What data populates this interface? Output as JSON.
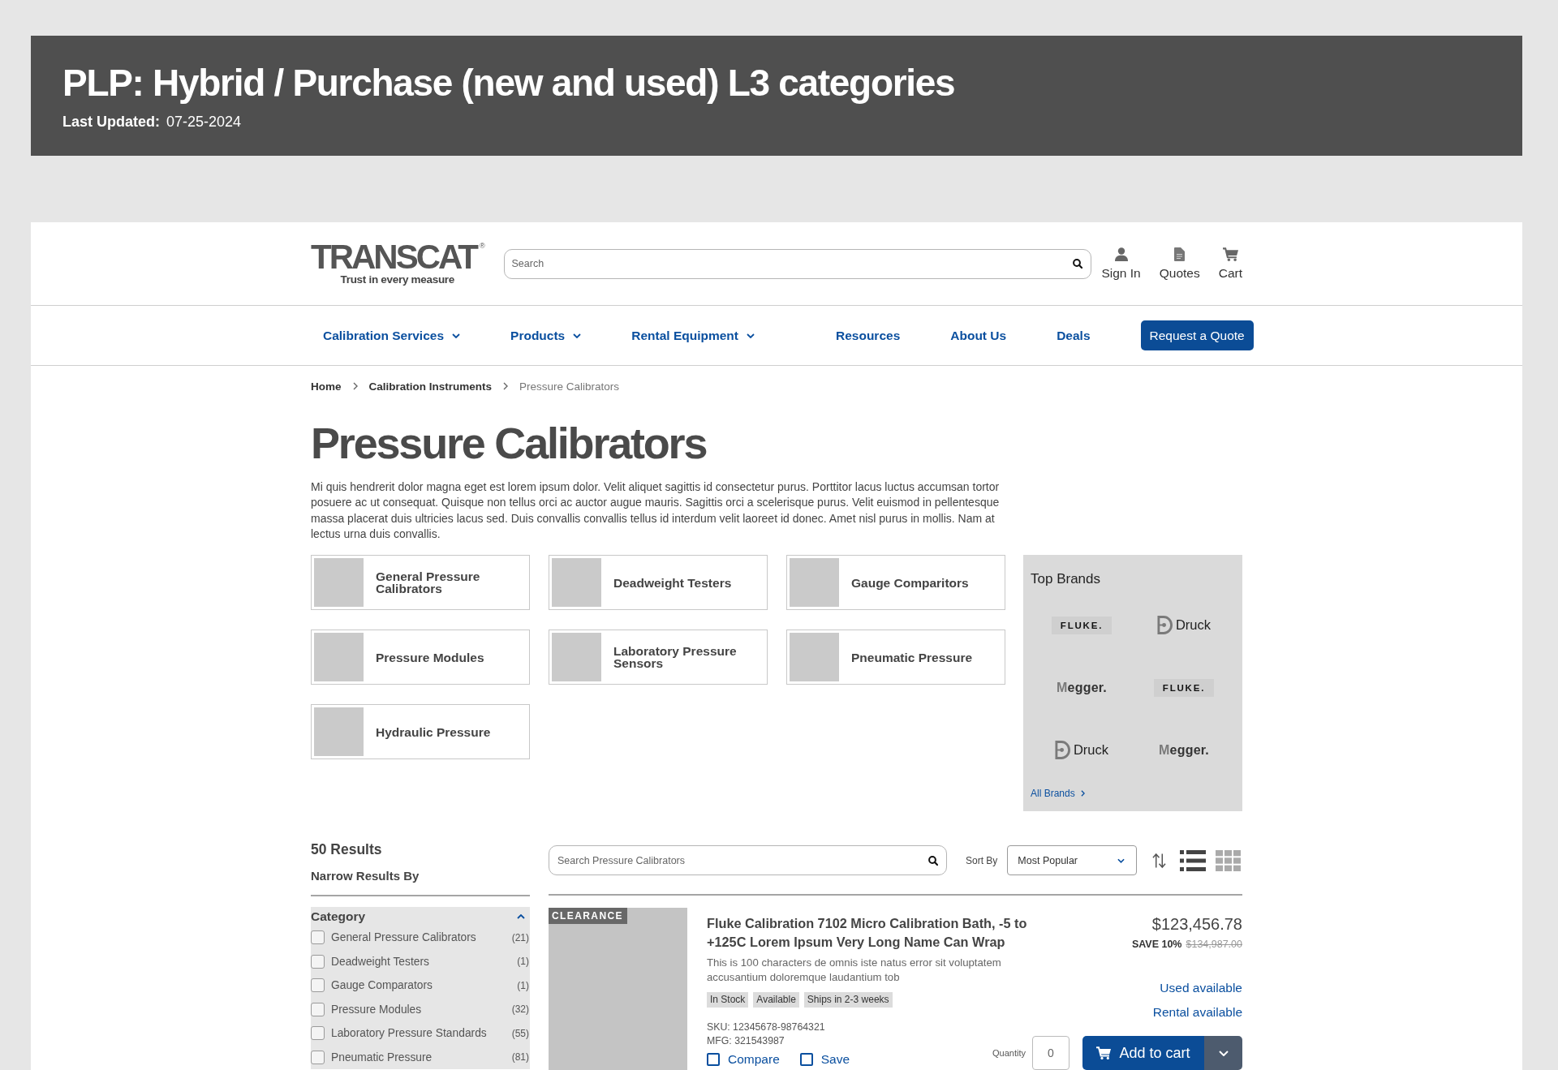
{
  "banner": {
    "title": "PLP: Hybrid / Purchase (new and used) L3 categories",
    "updated_label": "Last Updated:",
    "updated_value": "07-25-2024"
  },
  "header": {
    "logo": {
      "wordmark": "TRANSCAT",
      "registered": "®",
      "tagline": "Trust in every measure"
    },
    "search": {
      "placeholder": "Search"
    },
    "actions": [
      {
        "kind": "account",
        "label": "Sign In"
      },
      {
        "kind": "quotes",
        "label": "Quotes"
      },
      {
        "kind": "cart",
        "label": "Cart"
      }
    ]
  },
  "nav": {
    "items": [
      {
        "label": "Calibration Services",
        "dropdown": true
      },
      {
        "label": "Products",
        "dropdown": true
      },
      {
        "label": "Rental Equipment",
        "dropdown": true
      },
      {
        "label": "Resources",
        "dropdown": false
      },
      {
        "label": "About Us",
        "dropdown": false
      },
      {
        "label": "Deals",
        "dropdown": false
      }
    ],
    "cta": "Request a Quote"
  },
  "breadcrumb": [
    {
      "label": "Home",
      "current": false
    },
    {
      "label": "Calibration Instruments",
      "current": false
    },
    {
      "label": "Pressure Calibrators",
      "current": true
    }
  ],
  "page_title": "Pressure Calibrators",
  "intro": "Mi quis hendrerit dolor magna eget est lorem ipsum dolor. Velit aliquet sagittis id consectetur purus. Porttitor lacus luctus accumsan tortor posuere ac ut consequat. Quisque non tellus orci ac auctor augue mauris. Sagittis orci a scelerisque purus. Velit euismod in pellentesque massa placerat duis ultricies lacus sed. Duis convallis convallis tellus id interdum velit laoreet id donec. Amet nisl purus in mollis. Nam at lectus urna duis convallis.",
  "categories": [
    "General Pressure Calibrators",
    "Deadweight Testers",
    "Gauge Comparitors",
    "Pressure Modules",
    "Laboratory Pressure Sensors",
    "Pneumatic Pressure",
    "Hydraulic Pressure"
  ],
  "top_brands": {
    "title": "Top Brands",
    "brands": [
      {
        "kind": "boxed",
        "name": "FLUKE."
      },
      {
        "kind": "emblem",
        "name": "Druck"
      },
      {
        "kind": "wordmark",
        "name": "Megger."
      },
      {
        "kind": "boxed",
        "name": "FLUKE."
      },
      {
        "kind": "emblem",
        "name": "Druck"
      },
      {
        "kind": "wordmark",
        "name": "Megger."
      }
    ],
    "link": "All Brands"
  },
  "results": {
    "count": "50 Results",
    "narrow_heading": "Narrow Results By",
    "search": {
      "placeholder": "Search Pressure Calibrators"
    },
    "sort": {
      "label": "Sort By",
      "value": "Most Popular"
    },
    "views": [
      {
        "kind": "list",
        "selected": true
      },
      {
        "kind": "grid",
        "selected": false
      }
    ]
  },
  "filters": [
    {
      "title": "Category",
      "expanded": true,
      "options": [
        {
          "label": "General Pressure Calibrators",
          "count": "(21)",
          "checked": false
        },
        {
          "label": "Deadweight Testers",
          "count": "(1)",
          "checked": false
        },
        {
          "label": "Gauge Comparators",
          "count": "(1)",
          "checked": false
        },
        {
          "label": "Pressure Modules",
          "count": "(32)",
          "checked": false
        },
        {
          "label": "Laboratory Pressure Standards",
          "count": "(55)",
          "checked": false
        },
        {
          "label": "Pneumatic Pressure",
          "count": "(81)",
          "checked": false
        }
      ]
    }
  ],
  "products": [
    {
      "badge": "CLEARANCE",
      "title": "Fluke Calibration 7102 Micro Calibration Bath, -5 to +125C Lorem Ipsum Very Long Name Can Wrap",
      "description": "This is 100 characters de omnis iste natus error sit voluptatem accusantium doloremque laudantium tob",
      "tags": [
        "In Stock",
        "Available",
        "Ships in 2-3 weeks"
      ],
      "sku": "SKU: 12345678-98764321",
      "mfg": "MFG: 321543987",
      "price": "$123,456.78",
      "save": "SAVE 10%",
      "was_price": "$134,987.00",
      "availability": [
        "Used available",
        "Rental available"
      ],
      "compare": {
        "label": "Compare",
        "checked": false
      },
      "save_item": {
        "label": "Save",
        "checked": false
      },
      "quantity_label": "Quantity",
      "quantity": "0",
      "add_to_cart": "Add to cart"
    }
  ]
}
